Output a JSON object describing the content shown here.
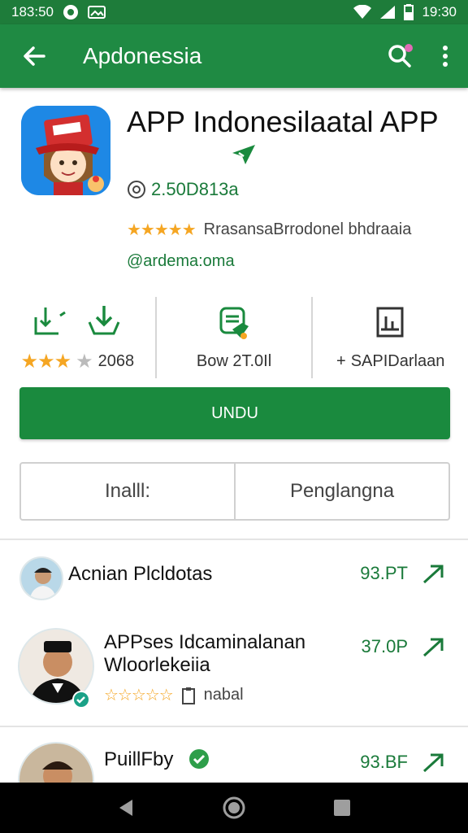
{
  "status_bar": {
    "time_left": "183:50",
    "time_right": "19:30"
  },
  "app_bar": {
    "title": "Apdonessia"
  },
  "app": {
    "title": "APP Indonesilaatal APP",
    "downloads": "2.50D813a",
    "rating_text": "RrasansaBrrodonel bhdraaia",
    "developer": "@ardema:oma"
  },
  "stats": [
    {
      "value": "2068",
      "stars": "★★★"
    },
    {
      "value": "Bow 2T.0Il"
    },
    {
      "value": "SAPIDarlaan"
    }
  ],
  "install_button": "UNDU",
  "segments": [
    "Inalll:",
    "Penglangna"
  ],
  "list": [
    {
      "title": "Acnian Plcldotas",
      "value": "93.PT"
    },
    {
      "title": "APPses Idcaminalanan Wloorlekeiia",
      "meta": "nabal",
      "value": "37.0P"
    },
    {
      "title": "PuillFby",
      "value": "93.BF"
    }
  ],
  "colors": {
    "primary": "#1f8a43",
    "accent": "#1a7a3a",
    "star": "#f5a623"
  }
}
